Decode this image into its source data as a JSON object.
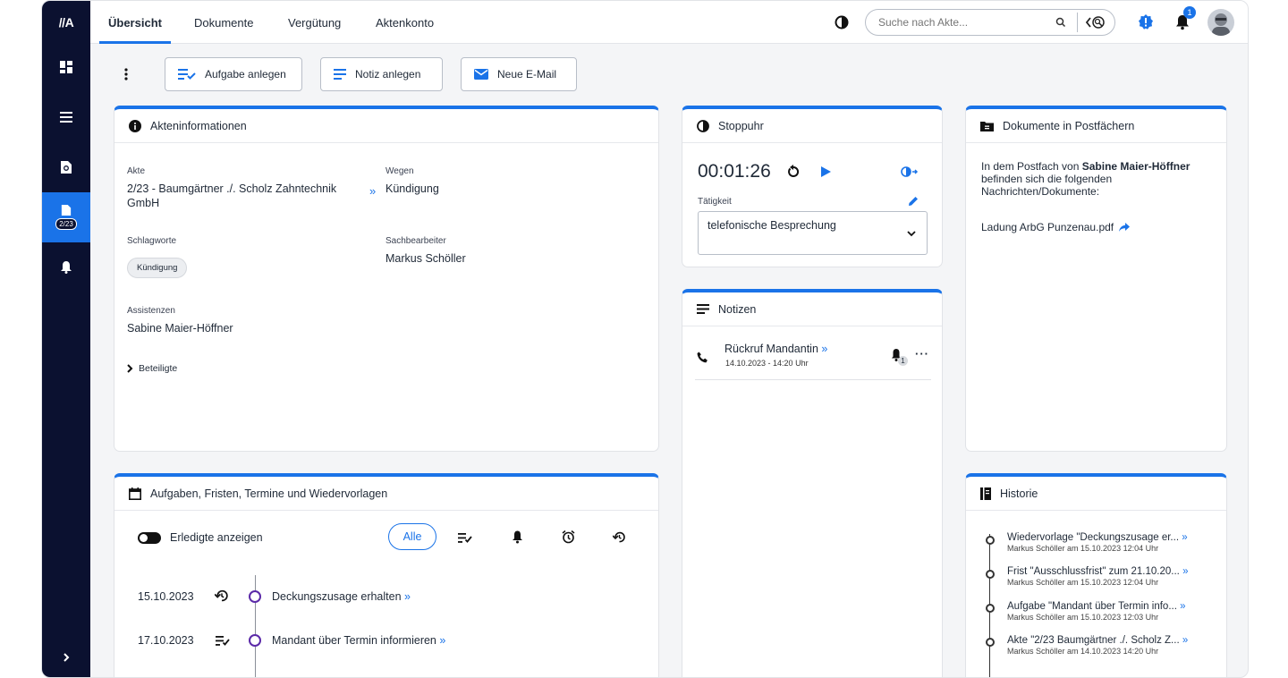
{
  "app": {
    "logo": "//A"
  },
  "sidebar": {
    "case_badge": "2/23"
  },
  "tabs": [
    "Übersicht",
    "Dokumente",
    "Vergütung",
    "Aktenkonto"
  ],
  "search": {
    "placeholder": "Suche nach Akte..."
  },
  "notifications": {
    "count": "1"
  },
  "toolbar": {
    "task": "Aufgabe anlegen",
    "note": "Notiz anlegen",
    "email": "Neue E-Mail"
  },
  "akte_info": {
    "title": "Akteninformationen",
    "akte_label": "Akte",
    "akte_value": "2/23 - Baumgärtner ./. Scholz Zahntechnik GmbH",
    "wegen_label": "Wegen",
    "wegen_value": "Kündigung",
    "schlagworte_label": "Schlagworte",
    "schlagwort_chip": "Kündigung",
    "sachbearbeiter_label": "Sachbearbeiter",
    "sachbearbeiter_value": "Markus Schöller",
    "assistenzen_label": "Assistenzen",
    "assistenzen_value": "Sabine Maier-Höffner",
    "beteiligte": "Beteiligte"
  },
  "stopwatch": {
    "title": "Stoppuhr",
    "time": "00:01:26",
    "activity_label": "Tätigkeit",
    "activity_value": "telefonische Besprechung"
  },
  "postfach": {
    "title": "Dokumente in Postfächern",
    "text_a": "In dem Postfach von ",
    "owner": "Sabine Maier-Höffner",
    "text_b": " befinden sich die folgenden Nachrichten/Dokumente:",
    "document": "Ladung ArbG Punzenau.pdf"
  },
  "notes": {
    "title": "Notizen",
    "items": [
      {
        "title": "Rückruf Mandantin",
        "date": "14.10.2023 - 14:20 Uhr",
        "reminders": "1"
      }
    ]
  },
  "tasks": {
    "title": "Aufgaben, Fristen, Termine und Wiedervorlagen",
    "toggle_label": "Erledigte anzeigen",
    "filter_all": "Alle",
    "items": [
      {
        "date": "15.10.2023",
        "title": "Deckungszusage erhalten"
      },
      {
        "date": "17.10.2023",
        "title": "Mandant über Termin informieren"
      }
    ]
  },
  "history": {
    "title": "Historie",
    "items": [
      {
        "title": "Wiedervorlage \"Deckungszusage er...",
        "sub": "Markus Schöller am 15.10.2023 12:04 Uhr"
      },
      {
        "title": "Frist \"Ausschlussfrist\" zum 21.10.20...",
        "sub": "Markus Schöller am 15.10.2023 12:04 Uhr"
      },
      {
        "title": "Aufgabe \"Mandant über Termin info...",
        "sub": "Markus Schöller am 15.10.2023 12:03 Uhr"
      },
      {
        "title": "Akte \"2/23 Baumgärtner ./. Scholz Z...",
        "sub": "Markus Schöller am 14.10.2023 14:20 Uhr"
      }
    ]
  },
  "colors": {
    "accent": "#1a73e8",
    "sidebar": "#0b1130"
  }
}
